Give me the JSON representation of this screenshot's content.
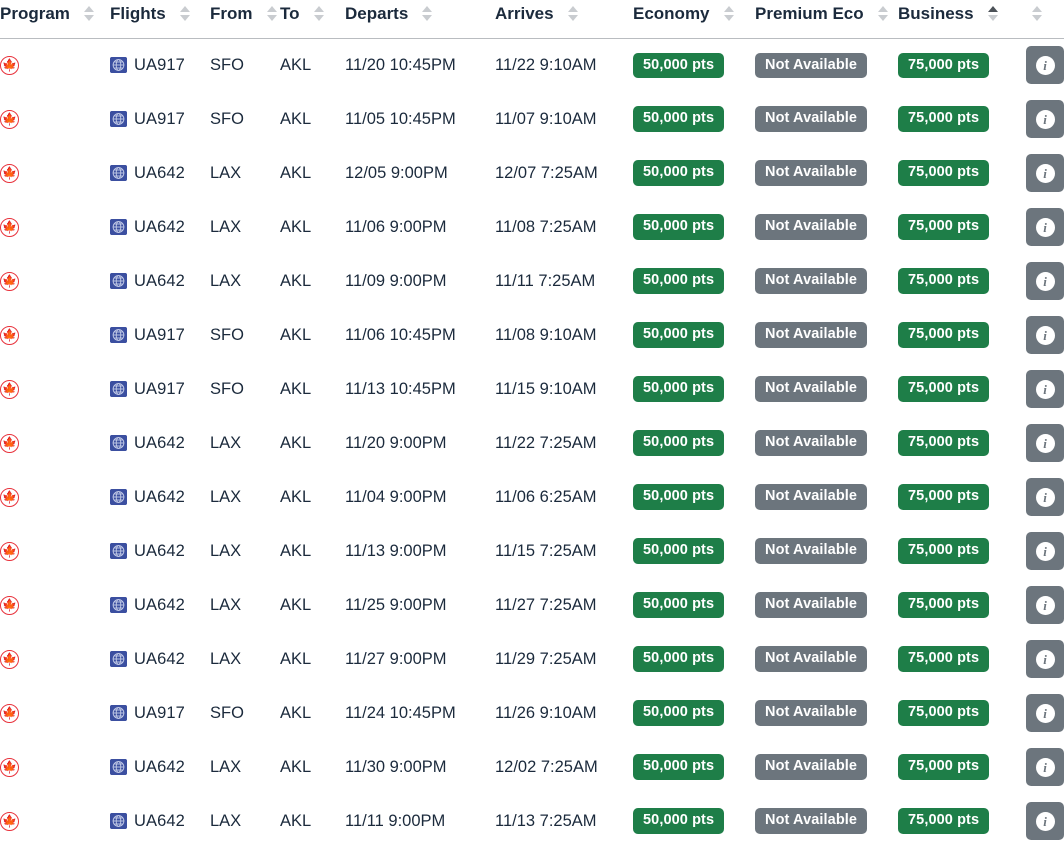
{
  "table": {
    "columns": [
      {
        "key": "program",
        "label": "Program",
        "sort": "none"
      },
      {
        "key": "flights",
        "label": "Flights",
        "sort": "none"
      },
      {
        "key": "from",
        "label": "From",
        "sort": "none"
      },
      {
        "key": "to",
        "label": "To",
        "sort": "none"
      },
      {
        "key": "departs",
        "label": "Departs",
        "sort": "none"
      },
      {
        "key": "arrives",
        "label": "Arrives",
        "sort": "none"
      },
      {
        "key": "economy",
        "label": "Economy",
        "sort": "none"
      },
      {
        "key": "premium",
        "label": "Premium Eco",
        "sort": "none"
      },
      {
        "key": "business",
        "label": "Business",
        "sort": "asc"
      },
      {
        "key": "info",
        "label": "",
        "sort": "none"
      }
    ],
    "icons": {
      "program": "aeroplan-maple-leaf-icon",
      "flight": "united-globe-icon",
      "info": "info-icon",
      "sort": "sort-arrows-icon"
    },
    "colors": {
      "available": "#1e7e48",
      "unavailable": "#6c757d",
      "info_button": "#6c757d",
      "text": "#1b2a3c",
      "header_border": "#b9bcc0",
      "program_icon": "#e8323c",
      "flight_icon": "#3b4fa0"
    },
    "rows": [
      {
        "program": "Aeroplan",
        "flight": "UA917",
        "from": "SFO",
        "to": "AKL",
        "departs": "11/20 10:45PM",
        "arrives": "11/22 9:10AM",
        "economy": "50,000 pts",
        "economy_state": "available",
        "premium": "Not Available",
        "premium_state": "unavailable",
        "business": "75,000 pts",
        "business_state": "available",
        "info": "i"
      },
      {
        "program": "Aeroplan",
        "flight": "UA917",
        "from": "SFO",
        "to": "AKL",
        "departs": "11/05 10:45PM",
        "arrives": "11/07 9:10AM",
        "economy": "50,000 pts",
        "economy_state": "available",
        "premium": "Not Available",
        "premium_state": "unavailable",
        "business": "75,000 pts",
        "business_state": "available",
        "info": "i"
      },
      {
        "program": "Aeroplan",
        "flight": "UA642",
        "from": "LAX",
        "to": "AKL",
        "departs": "12/05 9:00PM",
        "arrives": "12/07 7:25AM",
        "economy": "50,000 pts",
        "economy_state": "available",
        "premium": "Not Available",
        "premium_state": "unavailable",
        "business": "75,000 pts",
        "business_state": "available",
        "info": "i"
      },
      {
        "program": "Aeroplan",
        "flight": "UA642",
        "from": "LAX",
        "to": "AKL",
        "departs": "11/06 9:00PM",
        "arrives": "11/08 7:25AM",
        "economy": "50,000 pts",
        "economy_state": "available",
        "premium": "Not Available",
        "premium_state": "unavailable",
        "business": "75,000 pts",
        "business_state": "available",
        "info": "i"
      },
      {
        "program": "Aeroplan",
        "flight": "UA642",
        "from": "LAX",
        "to": "AKL",
        "departs": "11/09 9:00PM",
        "arrives": "11/11 7:25AM",
        "economy": "50,000 pts",
        "economy_state": "available",
        "premium": "Not Available",
        "premium_state": "unavailable",
        "business": "75,000 pts",
        "business_state": "available",
        "info": "i"
      },
      {
        "program": "Aeroplan",
        "flight": "UA917",
        "from": "SFO",
        "to": "AKL",
        "departs": "11/06 10:45PM",
        "arrives": "11/08 9:10AM",
        "economy": "50,000 pts",
        "economy_state": "available",
        "premium": "Not Available",
        "premium_state": "unavailable",
        "business": "75,000 pts",
        "business_state": "available",
        "info": "i"
      },
      {
        "program": "Aeroplan",
        "flight": "UA917",
        "from": "SFO",
        "to": "AKL",
        "departs": "11/13 10:45PM",
        "arrives": "11/15 9:10AM",
        "economy": "50,000 pts",
        "economy_state": "available",
        "premium": "Not Available",
        "premium_state": "unavailable",
        "business": "75,000 pts",
        "business_state": "available",
        "info": "i"
      },
      {
        "program": "Aeroplan",
        "flight": "UA642",
        "from": "LAX",
        "to": "AKL",
        "departs": "11/20 9:00PM",
        "arrives": "11/22 7:25AM",
        "economy": "50,000 pts",
        "economy_state": "available",
        "premium": "Not Available",
        "premium_state": "unavailable",
        "business": "75,000 pts",
        "business_state": "available",
        "info": "i"
      },
      {
        "program": "Aeroplan",
        "flight": "UA642",
        "from": "LAX",
        "to": "AKL",
        "departs": "11/04 9:00PM",
        "arrives": "11/06 6:25AM",
        "economy": "50,000 pts",
        "economy_state": "available",
        "premium": "Not Available",
        "premium_state": "unavailable",
        "business": "75,000 pts",
        "business_state": "available",
        "info": "i"
      },
      {
        "program": "Aeroplan",
        "flight": "UA642",
        "from": "LAX",
        "to": "AKL",
        "departs": "11/13 9:00PM",
        "arrives": "11/15 7:25AM",
        "economy": "50,000 pts",
        "economy_state": "available",
        "premium": "Not Available",
        "premium_state": "unavailable",
        "business": "75,000 pts",
        "business_state": "available",
        "info": "i"
      },
      {
        "program": "Aeroplan",
        "flight": "UA642",
        "from": "LAX",
        "to": "AKL",
        "departs": "11/25 9:00PM",
        "arrives": "11/27 7:25AM",
        "economy": "50,000 pts",
        "economy_state": "available",
        "premium": "Not Available",
        "premium_state": "unavailable",
        "business": "75,000 pts",
        "business_state": "available",
        "info": "i"
      },
      {
        "program": "Aeroplan",
        "flight": "UA642",
        "from": "LAX",
        "to": "AKL",
        "departs": "11/27 9:00PM",
        "arrives": "11/29 7:25AM",
        "economy": "50,000 pts",
        "economy_state": "available",
        "premium": "Not Available",
        "premium_state": "unavailable",
        "business": "75,000 pts",
        "business_state": "available",
        "info": "i"
      },
      {
        "program": "Aeroplan",
        "flight": "UA917",
        "from": "SFO",
        "to": "AKL",
        "departs": "11/24 10:45PM",
        "arrives": "11/26 9:10AM",
        "economy": "50,000 pts",
        "economy_state": "available",
        "premium": "Not Available",
        "premium_state": "unavailable",
        "business": "75,000 pts",
        "business_state": "available",
        "info": "i"
      },
      {
        "program": "Aeroplan",
        "flight": "UA642",
        "from": "LAX",
        "to": "AKL",
        "departs": "11/30 9:00PM",
        "arrives": "12/02 7:25AM",
        "economy": "50,000 pts",
        "economy_state": "available",
        "premium": "Not Available",
        "premium_state": "unavailable",
        "business": "75,000 pts",
        "business_state": "available",
        "info": "i"
      },
      {
        "program": "Aeroplan",
        "flight": "UA642",
        "from": "LAX",
        "to": "AKL",
        "departs": "11/11 9:00PM",
        "arrives": "11/13 7:25AM",
        "economy": "50,000 pts",
        "economy_state": "available",
        "premium": "Not Available",
        "premium_state": "unavailable",
        "business": "75,000 pts",
        "business_state": "available",
        "info": "i"
      }
    ]
  }
}
